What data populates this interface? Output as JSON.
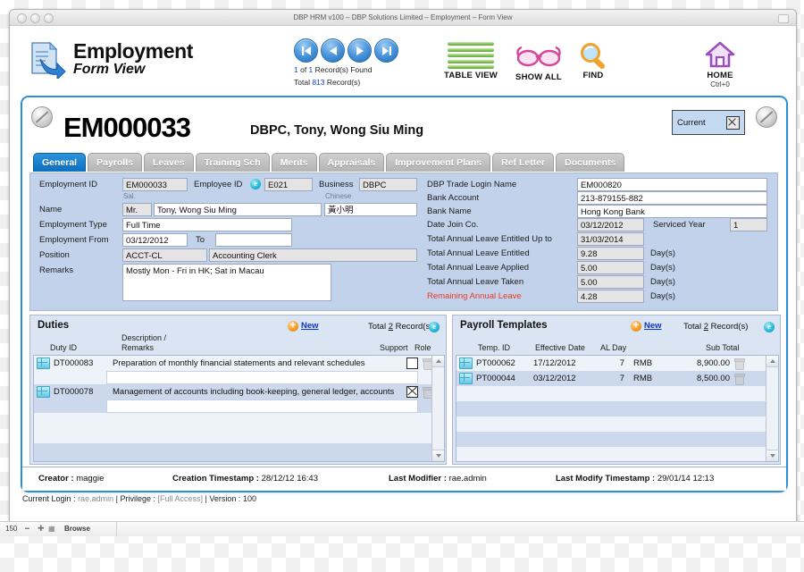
{
  "window": {
    "title": "DBP HRM v100 – DBP Solutions Limited – Employment – Form View"
  },
  "toolbar": {
    "app_title": "Employment",
    "app_subtitle": "Form View",
    "nav": {
      "record_found": "1 of 1 Record(s) Found",
      "record_current": "1",
      "record_total_found": "1",
      "total_label": "Total 813 Record(s)",
      "total_count": "813",
      "found_prefix": " of ",
      "found_suffix": " Record(s) Found",
      "total_prefix": "Total ",
      "total_suffix": " Record(s)"
    },
    "buttons": [
      {
        "label": "TABLE VIEW",
        "sub": ""
      },
      {
        "label": "SHOW ALL",
        "sub": ""
      },
      {
        "label": "FIND",
        "sub": ""
      },
      {
        "label": "HOME",
        "sub": "Ctrl+0"
      }
    ]
  },
  "record": {
    "id": "EM000033",
    "name": "DBPC, Tony, Wong Siu Ming",
    "status_label": "Current"
  },
  "tabs": [
    {
      "label": "General",
      "active": true
    },
    {
      "label": "Payrolls",
      "active": false
    },
    {
      "label": "Leaves",
      "active": false
    },
    {
      "label": "Training Sch",
      "active": false
    },
    {
      "label": "Merits",
      "active": false
    },
    {
      "label": "Appraisals",
      "active": false
    },
    {
      "label": "Improvement Plans",
      "active": false
    },
    {
      "label": "Ref Letter",
      "active": false
    },
    {
      "label": "Documents",
      "active": false
    }
  ],
  "form_left": {
    "employment_id_label": "Employment ID",
    "employment_id_value": "EM000033",
    "employee_id_label": "Employee ID",
    "employee_id_value": "E021",
    "employee_id_badge": "e",
    "business_label": "Business",
    "business_value": "DBPC",
    "salutation_label": "Sal.",
    "chinese_label": "Chinese",
    "name_label": "Name",
    "salutation_value": "Mr.",
    "name_value": "Tony, Wong Siu Ming",
    "chinese_value": "黃小明",
    "employment_type_label": "Employment Type",
    "employment_type_value": "Full Time",
    "employment_from_label": "Employment From",
    "employment_from_value": "03/12/2012",
    "to_label": "To",
    "to_value": "",
    "position_label": "Position",
    "position_code": "ACCT-CL",
    "position_name": "Accounting Clerk",
    "remarks_label": "Remarks",
    "remarks_value": "Mostly Mon - Fri in HK; Sat in Macau"
  },
  "form_right": {
    "rows": [
      {
        "label": "DBP Trade Login Name",
        "value": "EM000820",
        "unit": "",
        "red": false
      },
      {
        "label": "Bank Account",
        "value": "213-879155-882",
        "unit": "",
        "red": false
      },
      {
        "label": "Bank Name",
        "value": "Hong Kong Bank",
        "unit": "",
        "red": false
      },
      {
        "label": "Date Join Co.",
        "value": "03/12/2012",
        "unit": "",
        "red": false
      },
      {
        "label": "Total Annual Leave Entitled Up to",
        "value": "31/03/2014",
        "unit": "",
        "red": false
      },
      {
        "label": "Total Annual Leave Entitled",
        "value": "9.28",
        "unit": "Day(s)",
        "red": false
      },
      {
        "label": "Total Annual Leave Applied",
        "value": "5.00",
        "unit": "Day(s)",
        "red": false
      },
      {
        "label": "Total Annual Leave Taken",
        "value": "5.00",
        "unit": "Day(s)",
        "red": false
      },
      {
        "label": "Remaining Annual Leave",
        "value": "4.28",
        "unit": "Day(s)",
        "red": true
      }
    ],
    "serviced_year_label": "Serviced Year",
    "serviced_year_value": "1"
  },
  "duties": {
    "title": "Duties",
    "new_label": "New",
    "total_text_prefix": "Total ",
    "total_count": "2",
    "total_text_suffix": " Record(s)",
    "badge": "e",
    "columns": {
      "duty_id": "Duty ID",
      "description": "Description /",
      "remarks": "Remarks",
      "support": "Support",
      "role": "Role"
    },
    "rows": [
      {
        "duty_id": "DT000083",
        "description": "Preparation of monthly financial statements and relevant schedules",
        "remarks": "",
        "support": false
      },
      {
        "duty_id": "DT000078",
        "description": "Management of accounts including book-keeping, general ledger, accounts",
        "remarks": "",
        "support": true
      }
    ]
  },
  "payroll_templates": {
    "title": "Payroll Templates",
    "new_label": "New",
    "total_text_prefix": "Total ",
    "total_count": "2",
    "total_text_suffix": " Record(s)",
    "badge": "e",
    "columns": {
      "temp_id": "Temp. ID",
      "effective_date": "Effective Date",
      "al_day": "AL Day",
      "currency": "",
      "sub_total": "Sub Total"
    },
    "rows": [
      {
        "temp_id": "PT000062",
        "effective_date": "17/12/2012",
        "al_day": "7",
        "currency": "RMB",
        "sub_total": "8,900.00"
      },
      {
        "temp_id": "PT000044",
        "effective_date": "03/12/2012",
        "al_day": "7",
        "currency": "RMB",
        "sub_total": "8,500.00"
      }
    ]
  },
  "audit": {
    "creator_label": "Creator :",
    "creator_value": "maggie",
    "creation_label": "Creation Timestamp :",
    "creation_value": "28/12/12 16:43",
    "modifier_label": "Last Modifier :",
    "modifier_value": "rae.admin",
    "modify_ts_label": "Last Modify Timestamp :",
    "modify_ts_value": "29/01/14 12:13"
  },
  "statusbar": {
    "login_label": "Current Login :",
    "login_value": "rae.admin",
    "sep1": "|",
    "privilege_label": "Privilege :",
    "privilege_value": "[Full Access]",
    "sep2": "|",
    "version_label": "Version :",
    "version_value": "100"
  },
  "osbar": {
    "zoom": "150",
    "mode": "Browse"
  },
  "colors": {
    "accent_blue": "#0c6fc0",
    "panel_blue": "#c2d2ea",
    "sub_blue": "#dbe4f2",
    "link_blue": "#0b38c9",
    "alert_red": "#e83a26",
    "card_border": "#2e8fd6"
  }
}
